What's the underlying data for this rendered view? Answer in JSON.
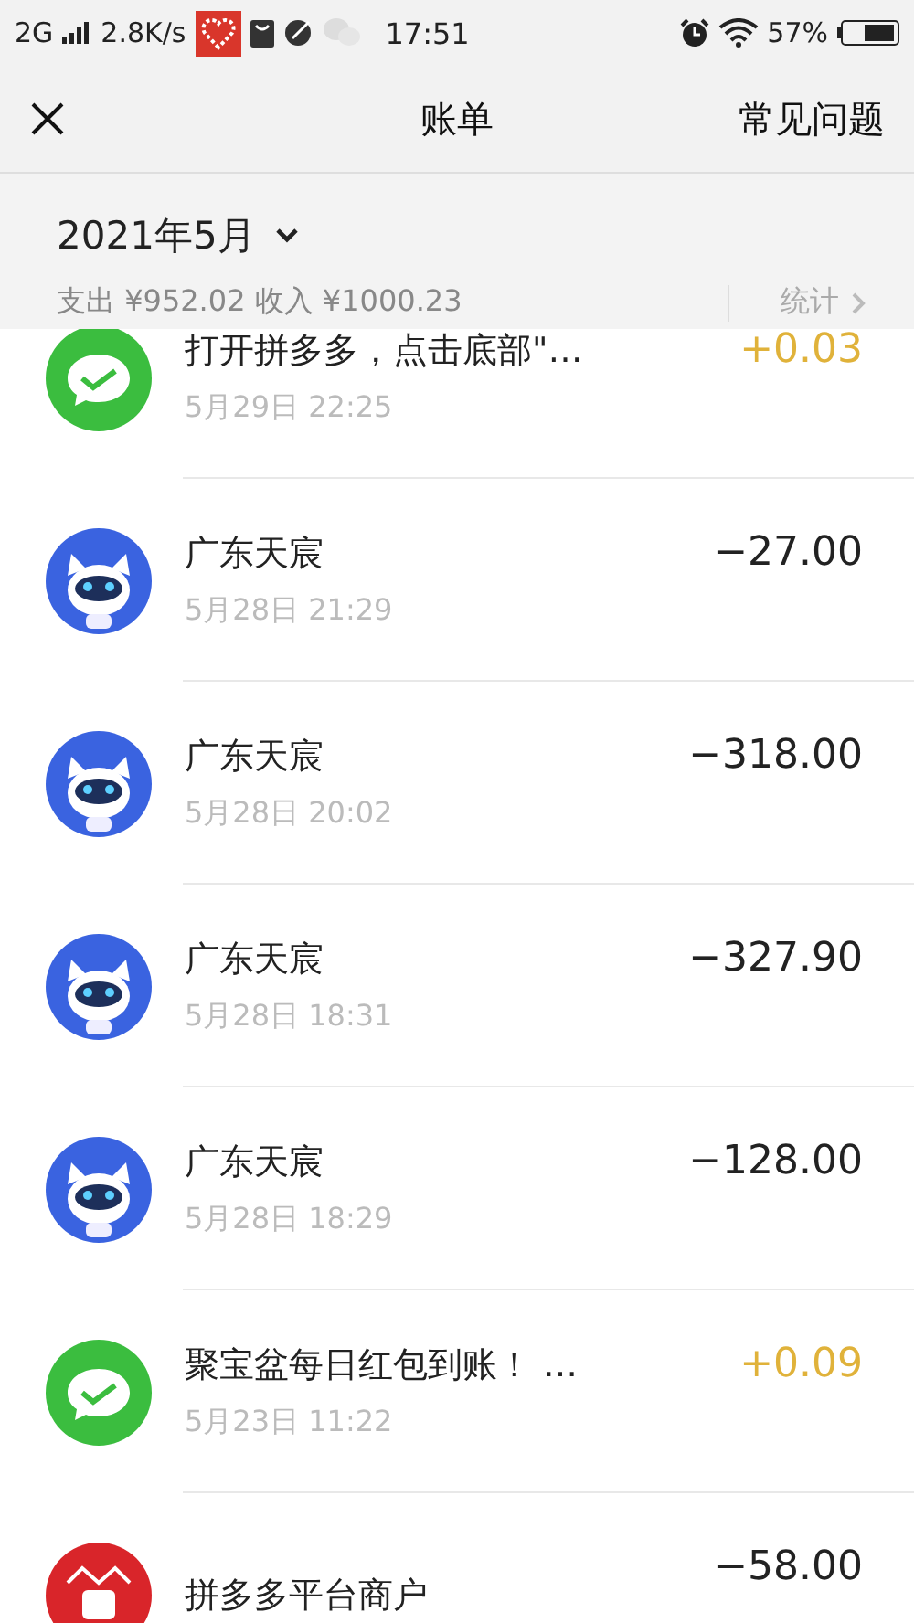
{
  "status_bar": {
    "network": "2G",
    "speed": "2.8K/s",
    "time": "17:51",
    "battery": "57%"
  },
  "nav": {
    "title": "账单",
    "action": "常见问题"
  },
  "summary": {
    "month": "2021年5月",
    "totals": "支出 ¥952.02 收入 ¥1000.23",
    "stats": "统计"
  },
  "records": [
    {
      "kind": "wechat",
      "title": "打开拼多多，点击底部\"…",
      "time": "5月29日 22:25",
      "amount": "+0.03",
      "income": true
    },
    {
      "kind": "robot",
      "title": "广东天宸",
      "time": "5月28日 21:29",
      "amount": "−27.00",
      "income": false
    },
    {
      "kind": "robot",
      "title": "广东天宸",
      "time": "5月28日 20:02",
      "amount": "−318.00",
      "income": false
    },
    {
      "kind": "robot",
      "title": "广东天宸",
      "time": "5月28日 18:31",
      "amount": "−327.90",
      "income": false
    },
    {
      "kind": "robot",
      "title": "广东天宸",
      "time": "5月28日 18:29",
      "amount": "−128.00",
      "income": false
    },
    {
      "kind": "wechat",
      "title": "聚宝盆每日红包到账！ …",
      "time": "5月23日 11:22",
      "amount": "+0.09",
      "income": true
    },
    {
      "kind": "pinduoduo",
      "title": "拼多多平台商户",
      "amount": "−58.00",
      "income": false
    }
  ]
}
